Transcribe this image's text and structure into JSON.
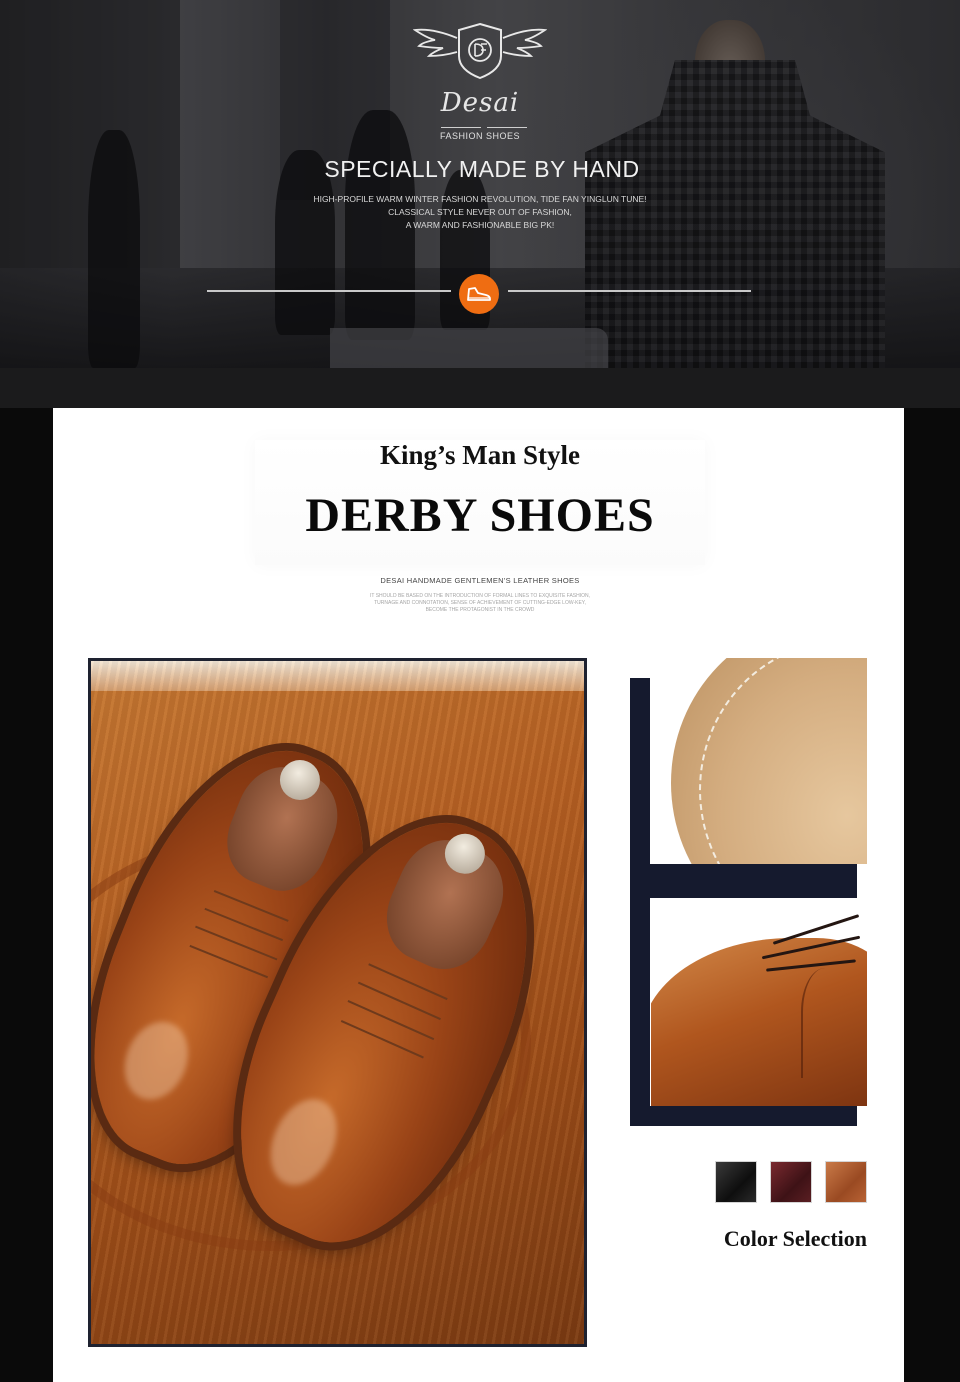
{
  "hero": {
    "brand_name": "Desai",
    "brand_tagline": "FASHION SHOES",
    "headline": "SPECIALLY MADE BY HAND",
    "lines": [
      "HIGH-PROFILE WARM WINTER FASHION REVOLUTION, TIDE FAN YINGLUN TUNE!",
      "CLASSICAL STYLE NEVER OUT OF FASHION,",
      "A WARM AND FASHIONABLE BIG PK!"
    ],
    "badge_icon": "shoe-icon",
    "accent_color": "#ef6d12"
  },
  "intro": {
    "kicker": "King’s Man Style",
    "headline": "DERBY SHOES",
    "subhead": "DESAI HANDMADE GENTLEMEN'S LEATHER SHOES",
    "desc_lines": [
      "IT SHOULD BE BASED ON THE INTRODUCTION OF FORMAL LINES TO EXQUISITE FASHION,",
      "TURNAGE AND CONNOTATION, SENSE OF ACHIEVEMENT OF CUTTING-EDGE LOW-KEY,",
      "BECOME THE PROTAGONIST IN THE CROWD"
    ]
  },
  "colors": {
    "label": "Color Selection",
    "swatches": [
      {
        "name": "black",
        "color": "#1a1a1a"
      },
      {
        "name": "wine",
        "color": "#5a1e22"
      },
      {
        "name": "brown",
        "color": "#a5532a"
      }
    ]
  }
}
